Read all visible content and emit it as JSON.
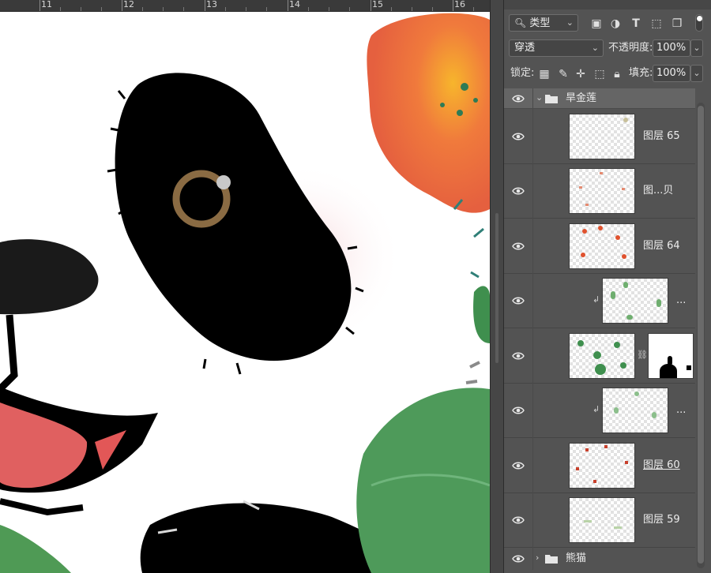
{
  "ruler": {
    "ticks": [
      "11",
      "12",
      "13",
      "14",
      "15",
      "16"
    ]
  },
  "layers_panel": {
    "filter": {
      "label": "类型",
      "icons": [
        "image-filter-icon",
        "adjustment-filter-icon",
        "type-filter-icon",
        "shape-filter-icon",
        "smart-object-filter-icon"
      ]
    },
    "blend_mode": "穿透",
    "opacity": {
      "label": "不透明度:",
      "value": "100%"
    },
    "lock": {
      "label": "锁定:"
    },
    "fill": {
      "label": "填充:",
      "value": "100%"
    },
    "group_top": {
      "name": "旱金莲",
      "expanded": true
    },
    "layers": [
      {
        "name": "图层 65",
        "clipped": false,
        "mask": false
      },
      {
        "name": "图...贝",
        "clipped": false,
        "mask": false
      },
      {
        "name": "图层 64",
        "clipped": false,
        "mask": false
      },
      {
        "name": "...",
        "clipped": true,
        "mask": false
      },
      {
        "name": "",
        "clipped": false,
        "mask": true
      },
      {
        "name": "...",
        "clipped": true,
        "mask": false
      },
      {
        "name": "图层 60",
        "clipped": false,
        "mask": false
      },
      {
        "name": "图层 59",
        "clipped": false,
        "mask": false
      }
    ],
    "group_bottom": {
      "name": "熊猫",
      "expanded": false
    }
  }
}
